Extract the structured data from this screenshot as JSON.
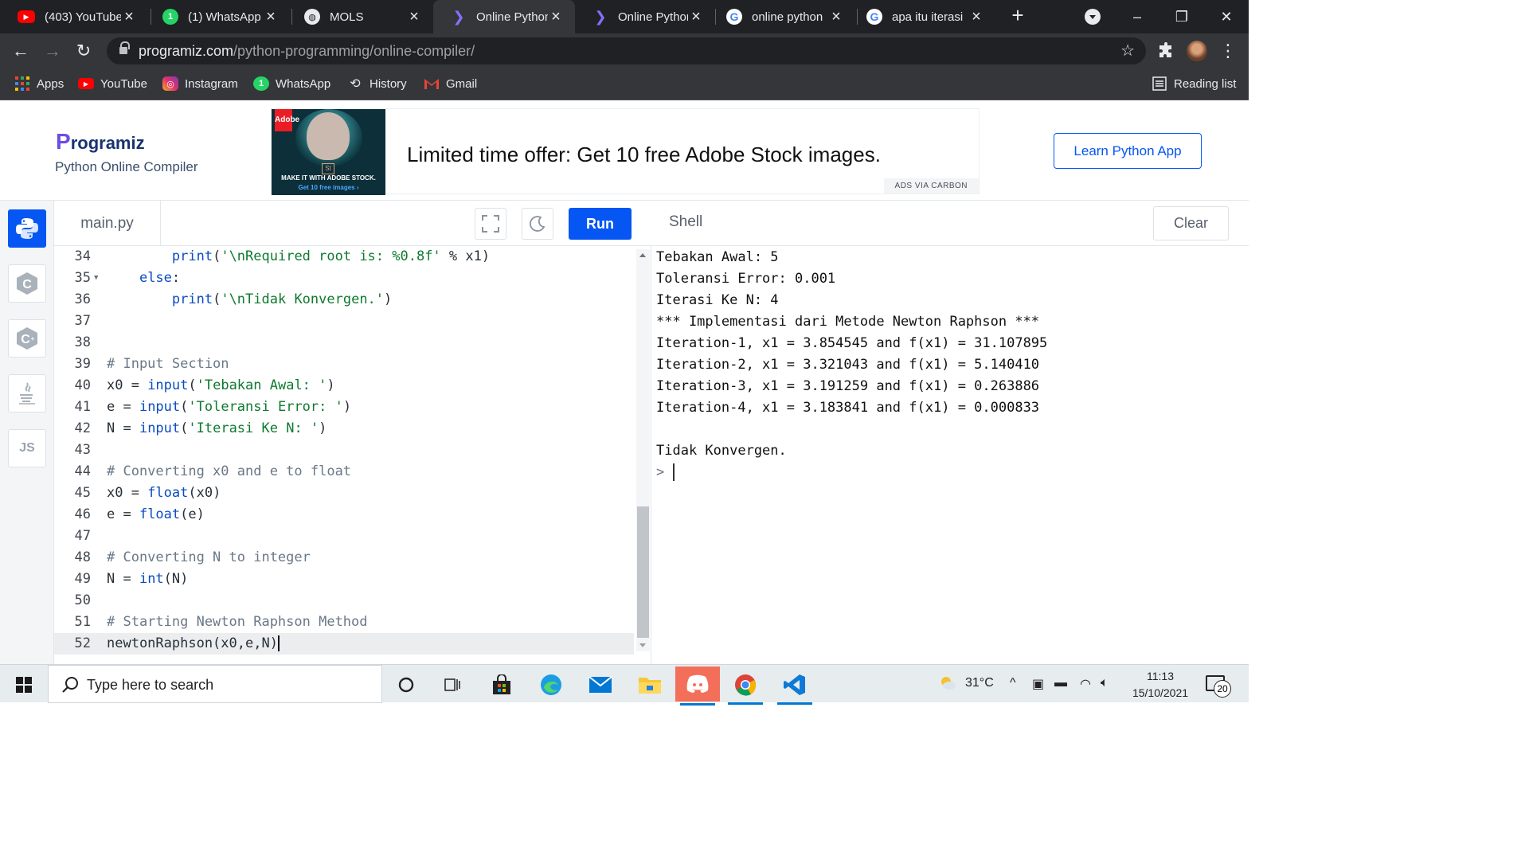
{
  "browser": {
    "tabs": [
      {
        "title": "(403) YouTube",
        "icon": "youtube-icon"
      },
      {
        "title": "(1) WhatsApp",
        "icon": "whatsapp-icon"
      },
      {
        "title": "MOLS",
        "icon": "globe-icon"
      },
      {
        "title": "Online Python",
        "icon": "programiz-icon",
        "active": true
      },
      {
        "title": "Online Python",
        "icon": "programiz-icon"
      },
      {
        "title": "online python",
        "icon": "google-icon"
      },
      {
        "title": "apa itu iterasi",
        "icon": "google-icon"
      }
    ],
    "url_host": "programiz.com",
    "url_path": "/python-programming/online-compiler/",
    "bookmarks": [
      {
        "label": "Apps",
        "icon": "apps-grid-icon"
      },
      {
        "label": "YouTube",
        "icon": "youtube-icon"
      },
      {
        "label": "Instagram",
        "icon": "instagram-icon"
      },
      {
        "label": "WhatsApp",
        "icon": "whatsapp-icon"
      },
      {
        "label": "History",
        "icon": "history-icon"
      },
      {
        "label": "Gmail",
        "icon": "gmail-icon"
      }
    ],
    "reading_list": "Reading list"
  },
  "header": {
    "logo_first": "P",
    "logo_rest": "rogramiz",
    "subtitle": "Python Online Compiler",
    "ad_text": "Limited time offer: Get 10 free Adobe Stock images.",
    "ad_caption_1": "MAKE IT WITH ADOBE STOCK.",
    "ad_caption_2": "Get 10 free images ›",
    "ad_badge": "Adobe",
    "ad_st": "St",
    "ads_via": "ADS VIA CARBON",
    "learn_button": "Learn Python App"
  },
  "rail": {
    "languages": [
      {
        "name": "python",
        "label": "",
        "active": true
      },
      {
        "name": "c",
        "label": "C"
      },
      {
        "name": "cpp",
        "label": "C"
      },
      {
        "name": "java",
        "label": ""
      },
      {
        "name": "js",
        "label": "JS"
      }
    ]
  },
  "editor": {
    "file_tab": "main.py",
    "run_label": "Run",
    "lines": [
      {
        "n": "34",
        "fold": false,
        "html": "        <span class=\"kw\">print</span>(<span class=\"str\">'\\nRequired root is: %0.8f'</span> % x1)"
      },
      {
        "n": "35",
        "fold": true,
        "html": "    <span class=\"kw\">else</span>:"
      },
      {
        "n": "36",
        "fold": false,
        "html": "        <span class=\"kw\">print</span>(<span class=\"str\">'\\nTidak Konvergen.'</span>)"
      },
      {
        "n": "37",
        "fold": false,
        "html": ""
      },
      {
        "n": "38",
        "fold": false,
        "html": ""
      },
      {
        "n": "39",
        "fold": false,
        "html": "<span class=\"cmt\"># Input Section</span>"
      },
      {
        "n": "40",
        "fold": false,
        "html": "x0 = <span class=\"kw\">input</span>(<span class=\"str\">'Tebakan Awal: '</span>)"
      },
      {
        "n": "41",
        "fold": false,
        "html": "e = <span class=\"kw\">input</span>(<span class=\"str\">'Toleransi Error: '</span>)"
      },
      {
        "n": "42",
        "fold": false,
        "html": "N = <span class=\"kw\">input</span>(<span class=\"str\">'Iterasi Ke N: '</span>)"
      },
      {
        "n": "43",
        "fold": false,
        "html": ""
      },
      {
        "n": "44",
        "fold": false,
        "html": "<span class=\"cmt\"># Converting x0 and e to float</span>"
      },
      {
        "n": "45",
        "fold": false,
        "html": "x0 = <span class=\"kw\">float</span>(x0)"
      },
      {
        "n": "46",
        "fold": false,
        "html": "e = <span class=\"kw\">float</span>(e)"
      },
      {
        "n": "47",
        "fold": false,
        "html": ""
      },
      {
        "n": "48",
        "fold": false,
        "html": "<span class=\"cmt\"># Converting N to integer</span>"
      },
      {
        "n": "49",
        "fold": false,
        "html": "N = <span class=\"kw\">int</span>(N)"
      },
      {
        "n": "50",
        "fold": false,
        "html": ""
      },
      {
        "n": "51",
        "fold": false,
        "html": "<span class=\"cmt\"># Starting Newton Raphson Method</span>"
      },
      {
        "n": "52",
        "fold": false,
        "html": "newtonRaphson(x0,e,N)<span class=\"caret\"></span>",
        "current": true
      }
    ]
  },
  "shell": {
    "title": "Shell",
    "clear_label": "Clear",
    "lines": [
      "Tebakan Awal: 5",
      "Toleransi Error: 0.001",
      "Iterasi Ke N: 4",
      "*** Implementasi dari Metode Newton Raphson ***",
      "Iteration-1, x1 = 3.854545 and f(x1) = 31.107895",
      "Iteration-2, x1 = 3.321043 and f(x1) = 5.140410",
      "Iteration-3, x1 = 3.191259 and f(x1) = 0.263886",
      "Iteration-4, x1 = 3.183841 and f(x1) = 0.000833",
      "",
      "Tidak Konvergen."
    ],
    "prompt": ">"
  },
  "taskbar": {
    "search_placeholder": "Type here to search",
    "temperature": "31°C",
    "time": "11:13",
    "date": "15/10/2021",
    "notifications": "20"
  }
}
